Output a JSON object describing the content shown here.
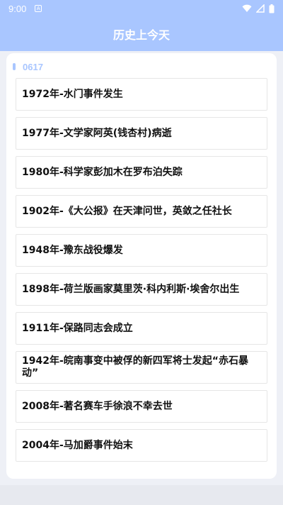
{
  "status_bar": {
    "time": "9:00",
    "icons": [
      "a-notification-icon",
      "wifi-icon",
      "signal-icon",
      "battery-icon"
    ]
  },
  "app_bar": {
    "title": "历史上今天"
  },
  "date_label": "0617",
  "events": [
    "1972年-水门事件发生",
    "1977年-文学家阿英(钱杏村)病逝",
    "1980年-科学家彭加木在罗布泊失踪",
    "1902年-《大公报》在天津问世，英敛之任社长",
    "1948年-豫东战役爆发",
    "1898年-荷兰版画家莫里茨·科内利斯·埃舍尔出生",
    "1911年-保路同志会成立",
    "1942年-皖南事变中被俘的新四军将士发起“赤石暴动”",
    "2008年-著名赛车手徐浪不幸去世",
    "2004年-马加爵事件始末"
  ],
  "colors": {
    "accent": "#a9c6ff",
    "background": "#eef0f6",
    "text": "#111111"
  }
}
